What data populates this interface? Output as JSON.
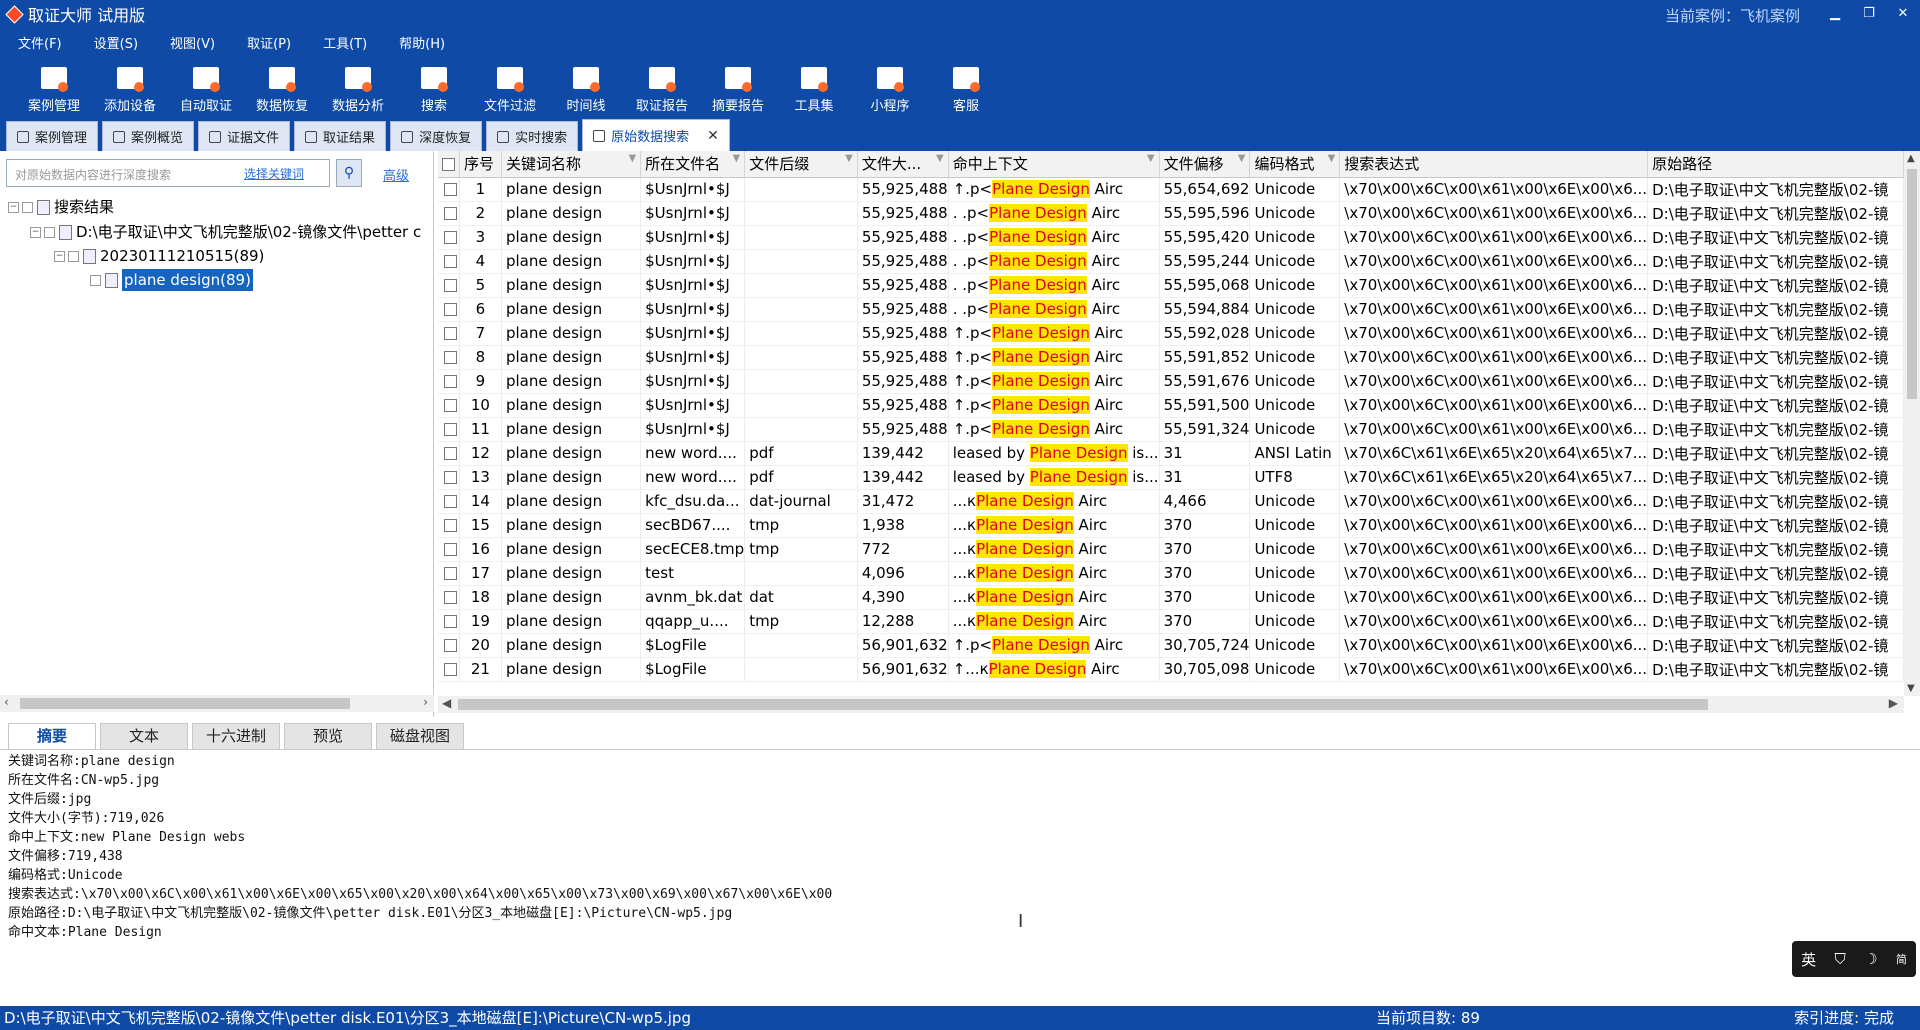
{
  "app": {
    "title": "取证大师 试用版",
    "current_case": "当前案例：飞机案例"
  },
  "menu": [
    "文件(F)",
    "设置(S)",
    "视图(V)",
    "取证(P)",
    "工具(T)",
    "帮助(H)"
  ],
  "toolbar": [
    {
      "label": "案例管理",
      "icon": "case-folder-icon"
    },
    {
      "label": "添加设备",
      "icon": "add-device-icon"
    },
    {
      "label": "自动取证",
      "icon": "auto-forensics-icon"
    },
    {
      "label": "数据恢复",
      "icon": "data-recovery-icon"
    },
    {
      "label": "数据分析",
      "icon": "data-analysis-icon"
    },
    {
      "label": "搜索",
      "icon": "search-icon"
    },
    {
      "label": "文件过滤",
      "icon": "file-filter-icon"
    },
    {
      "label": "时间线",
      "icon": "timeline-icon"
    },
    {
      "label": "取证报告",
      "icon": "report-icon"
    },
    {
      "label": "摘要报告",
      "icon": "summary-report-icon"
    },
    {
      "label": "工具集",
      "icon": "toolset-icon"
    },
    {
      "label": "小程序",
      "icon": "miniprogram-icon"
    },
    {
      "label": "客服",
      "icon": "customer-service-icon"
    }
  ],
  "tabs": [
    "案例管理",
    "案例概览",
    "证据文件",
    "取证结果",
    "深度恢复",
    "实时搜索",
    "原始数据搜索"
  ],
  "left_panel": {
    "search_placeholder": "对原始数据内容进行深度搜索",
    "keyword_link": "选择关键词",
    "advanced_link": "高级",
    "tree": {
      "root": "搜索结果",
      "evidence": "D:\\电子取证\\中文飞机完整版\\02-镜像文件\\petter c",
      "session": "20230111210515(89)",
      "keyword": "plane design(89)"
    }
  },
  "grid": {
    "columns": [
      "序号",
      "关键词名称",
      "所在文件名",
      "文件后缀",
      "文件大...",
      "命中上下文",
      "文件偏移",
      "编码格式",
      "搜索表达式",
      "原始路径"
    ],
    "rows": [
      {
        "n": "1",
        "kw": "plane design",
        "file": "$UsnJrnl•$J",
        "ext": "",
        "size": "55,925,488",
        "pre": "↑.p<",
        "hit": "Plane Design",
        "post": " Airc",
        "offset": "55,654,692",
        "enc": "Unicode",
        "expr": "\\x70\\x00\\x6C\\x00\\x61\\x00\\x6E\\x00\\x6...",
        "path": "D:\\电子取证\\中文飞机完整版\\02-镜"
      },
      {
        "n": "2",
        "kw": "plane design",
        "file": "$UsnJrnl•$J",
        "ext": "",
        "size": "55,925,488",
        "pre": ". .p<",
        "hit": "Plane Design",
        "post": " Airc",
        "offset": "55,595,596",
        "enc": "Unicode",
        "expr": "\\x70\\x00\\x6C\\x00\\x61\\x00\\x6E\\x00\\x6...",
        "path": "D:\\电子取证\\中文飞机完整版\\02-镜"
      },
      {
        "n": "3",
        "kw": "plane design",
        "file": "$UsnJrnl•$J",
        "ext": "",
        "size": "55,925,488",
        "pre": ". .p<",
        "hit": "Plane Design",
        "post": " Airc",
        "offset": "55,595,420",
        "enc": "Unicode",
        "expr": "\\x70\\x00\\x6C\\x00\\x61\\x00\\x6E\\x00\\x6...",
        "path": "D:\\电子取证\\中文飞机完整版\\02-镜"
      },
      {
        "n": "4",
        "kw": "plane design",
        "file": "$UsnJrnl•$J",
        "ext": "",
        "size": "55,925,488",
        "pre": ". .p<",
        "hit": "Plane Design",
        "post": " Airc",
        "offset": "55,595,244",
        "enc": "Unicode",
        "expr": "\\x70\\x00\\x6C\\x00\\x61\\x00\\x6E\\x00\\x6...",
        "path": "D:\\电子取证\\中文飞机完整版\\02-镜"
      },
      {
        "n": "5",
        "kw": "plane design",
        "file": "$UsnJrnl•$J",
        "ext": "",
        "size": "55,925,488",
        "pre": ". .p<",
        "hit": "Plane Design",
        "post": " Airc",
        "offset": "55,595,068",
        "enc": "Unicode",
        "expr": "\\x70\\x00\\x6C\\x00\\x61\\x00\\x6E\\x00\\x6...",
        "path": "D:\\电子取证\\中文飞机完整版\\02-镜"
      },
      {
        "n": "6",
        "kw": "plane design",
        "file": "$UsnJrnl•$J",
        "ext": "",
        "size": "55,925,488",
        "pre": ". .p<",
        "hit": "Plane Design",
        "post": " Airc",
        "offset": "55,594,884",
        "enc": "Unicode",
        "expr": "\\x70\\x00\\x6C\\x00\\x61\\x00\\x6E\\x00\\x6...",
        "path": "D:\\电子取证\\中文飞机完整版\\02-镜"
      },
      {
        "n": "7",
        "kw": "plane design",
        "file": "$UsnJrnl•$J",
        "ext": "",
        "size": "55,925,488",
        "pre": "↑.p<",
        "hit": "Plane Design",
        "post": " Airc",
        "offset": "55,592,028",
        "enc": "Unicode",
        "expr": "\\x70\\x00\\x6C\\x00\\x61\\x00\\x6E\\x00\\x6...",
        "path": "D:\\电子取证\\中文飞机完整版\\02-镜"
      },
      {
        "n": "8",
        "kw": "plane design",
        "file": "$UsnJrnl•$J",
        "ext": "",
        "size": "55,925,488",
        "pre": "↑.p<",
        "hit": "Plane Design",
        "post": " Airc",
        "offset": "55,591,852",
        "enc": "Unicode",
        "expr": "\\x70\\x00\\x6C\\x00\\x61\\x00\\x6E\\x00\\x6...",
        "path": "D:\\电子取证\\中文飞机完整版\\02-镜"
      },
      {
        "n": "9",
        "kw": "plane design",
        "file": "$UsnJrnl•$J",
        "ext": "",
        "size": "55,925,488",
        "pre": "↑.p<",
        "hit": "Plane Design",
        "post": " Airc",
        "offset": "55,591,676",
        "enc": "Unicode",
        "expr": "\\x70\\x00\\x6C\\x00\\x61\\x00\\x6E\\x00\\x6...",
        "path": "D:\\电子取证\\中文飞机完整版\\02-镜"
      },
      {
        "n": "10",
        "kw": "plane design",
        "file": "$UsnJrnl•$J",
        "ext": "",
        "size": "55,925,488",
        "pre": "↑.p<",
        "hit": "Plane Design",
        "post": " Airc",
        "offset": "55,591,500",
        "enc": "Unicode",
        "expr": "\\x70\\x00\\x6C\\x00\\x61\\x00\\x6E\\x00\\x6...",
        "path": "D:\\电子取证\\中文飞机完整版\\02-镜"
      },
      {
        "n": "11",
        "kw": "plane design",
        "file": "$UsnJrnl•$J",
        "ext": "",
        "size": "55,925,488",
        "pre": "↑.p<",
        "hit": "Plane Design",
        "post": " Airc",
        "offset": "55,591,324",
        "enc": "Unicode",
        "expr": "\\x70\\x00\\x6C\\x00\\x61\\x00\\x6E\\x00\\x6...",
        "path": "D:\\电子取证\\中文飞机完整版\\02-镜"
      },
      {
        "n": "12",
        "kw": "plane design",
        "file": "new word....",
        "ext": "pdf",
        "size": "139,442",
        "pre": "leased by ",
        "hit": "Plane Design",
        "post": " is...",
        "offset": "31",
        "enc": "ANSI Latin",
        "expr": "\\x70\\x6C\\x61\\x6E\\x65\\x20\\x64\\x65\\x7...",
        "path": "D:\\电子取证\\中文飞机完整版\\02-镜"
      },
      {
        "n": "13",
        "kw": "plane design",
        "file": "new word....",
        "ext": "pdf",
        "size": "139,442",
        "pre": "leased by ",
        "hit": "Plane Design",
        "post": " is...",
        "offset": "31",
        "enc": "UTF8",
        "expr": "\\x70\\x6C\\x61\\x6E\\x65\\x20\\x64\\x65\\x7...",
        "path": "D:\\电子取证\\中文飞机完整版\\02-镜"
      },
      {
        "n": "14",
        "kw": "plane design",
        "file": "kfc_dsu.da...",
        "ext": "dat-journal",
        "size": "31,472",
        "pre": "...к",
        "hit": "Plane Design",
        "post": " Airc",
        "offset": "4,466",
        "enc": "Unicode",
        "expr": "\\x70\\x00\\x6C\\x00\\x61\\x00\\x6E\\x00\\x6...",
        "path": "D:\\电子取证\\中文飞机完整版\\02-镜"
      },
      {
        "n": "15",
        "kw": "plane design",
        "file": "secBD67....",
        "ext": "tmp",
        "size": "1,938",
        "pre": "...к",
        "hit": "Plane Design",
        "post": " Airc",
        "offset": "370",
        "enc": "Unicode",
        "expr": "\\x70\\x00\\x6C\\x00\\x61\\x00\\x6E\\x00\\x6...",
        "path": "D:\\电子取证\\中文飞机完整版\\02-镜"
      },
      {
        "n": "16",
        "kw": "plane design",
        "file": "secECE8.tmp",
        "ext": "tmp",
        "size": "772",
        "pre": "...к",
        "hit": "Plane Design",
        "post": " Airc",
        "offset": "370",
        "enc": "Unicode",
        "expr": "\\x70\\x00\\x6C\\x00\\x61\\x00\\x6E\\x00\\x6...",
        "path": "D:\\电子取证\\中文飞机完整版\\02-镜"
      },
      {
        "n": "17",
        "kw": "plane design",
        "file": "test",
        "ext": "",
        "size": "4,096",
        "pre": "...к",
        "hit": "Plane Design",
        "post": " Airc",
        "offset": "370",
        "enc": "Unicode",
        "expr": "\\x70\\x00\\x6C\\x00\\x61\\x00\\x6E\\x00\\x6...",
        "path": "D:\\电子取证\\中文飞机完整版\\02-镜"
      },
      {
        "n": "18",
        "kw": "plane design",
        "file": "avnm_bk.dat",
        "ext": "dat",
        "size": "4,390",
        "pre": "...к",
        "hit": "Plane Design",
        "post": " Airc",
        "offset": "370",
        "enc": "Unicode",
        "expr": "\\x70\\x00\\x6C\\x00\\x61\\x00\\x6E\\x00\\x6...",
        "path": "D:\\电子取证\\中文飞机完整版\\02-镜"
      },
      {
        "n": "19",
        "kw": "plane design",
        "file": "qqapp_u....",
        "ext": "tmp",
        "size": "12,288",
        "pre": "...к",
        "hit": "Plane Design",
        "post": " Airc",
        "offset": "370",
        "enc": "Unicode",
        "expr": "\\x70\\x00\\x6C\\x00\\x61\\x00\\x6E\\x00\\x6...",
        "path": "D:\\电子取证\\中文飞机完整版\\02-镜"
      },
      {
        "n": "20",
        "kw": "plane design",
        "file": "$LogFile",
        "ext": "",
        "size": "56,901,632",
        "pre": "↑.p<",
        "hit": "Plane Design",
        "post": " Airc",
        "offset": "30,705,724",
        "enc": "Unicode",
        "expr": "\\x70\\x00\\x6C\\x00\\x61\\x00\\x6E\\x00\\x6...",
        "path": "D:\\电子取证\\中文飞机完整版\\02-镜"
      },
      {
        "n": "21",
        "kw": "plane design",
        "file": "$LogFile",
        "ext": "",
        "size": "56,901,632",
        "pre": "↑...к",
        "hit": "Plane Design",
        "post": " Airc",
        "offset": "30,705,098",
        "enc": "Unicode",
        "expr": "\\x70\\x00\\x6C\\x00\\x61\\x00\\x6E\\x00\\x6...",
        "path": "D:\\电子取证\\中文飞机完整版\\02-镜"
      }
    ]
  },
  "bottom_tabs": [
    "摘要",
    "文本",
    "十六进制",
    "预览",
    "磁盘视图"
  ],
  "detail_lines": [
    "关键词名称:plane design",
    "所在文件名:CN-wp5.jpg",
    "文件后缀:jpg",
    "文件大小(字节):719,026",
    "命中上下文:new Plane Design webs",
    "文件偏移:719,438",
    "编码格式:Unicode",
    "搜索表达式:\\x70\\x00\\x6C\\x00\\x61\\x00\\x6E\\x00\\x65\\x00\\x20\\x00\\x64\\x00\\x65\\x00\\x73\\x00\\x69\\x00\\x67\\x00\\x6E\\x00",
    "原始路径:D:\\电子取证\\中文飞机完整版\\02-镜像文件\\petter disk.E01\\分区3_本地磁盘[E]:\\Picture\\CN-wp5.jpg",
    "命中文本:Plane Design"
  ],
  "ime": {
    "lang": "英",
    "shirt": "👕",
    "moon": "☽",
    "extra": "简"
  },
  "status": {
    "path": "D:\\电子取证\\中文飞机完整版\\02-镜像文件\\petter disk.E01\\分区3_本地磁盘[E]:\\Picture\\CN-wp5.jpg",
    "count": "当前项目数: 89",
    "progress": "索引进度: 完成"
  },
  "colors": {
    "brand": "#0e4aa6",
    "highlight_bg": "#ffe600",
    "highlight_text": "#e0002a"
  }
}
